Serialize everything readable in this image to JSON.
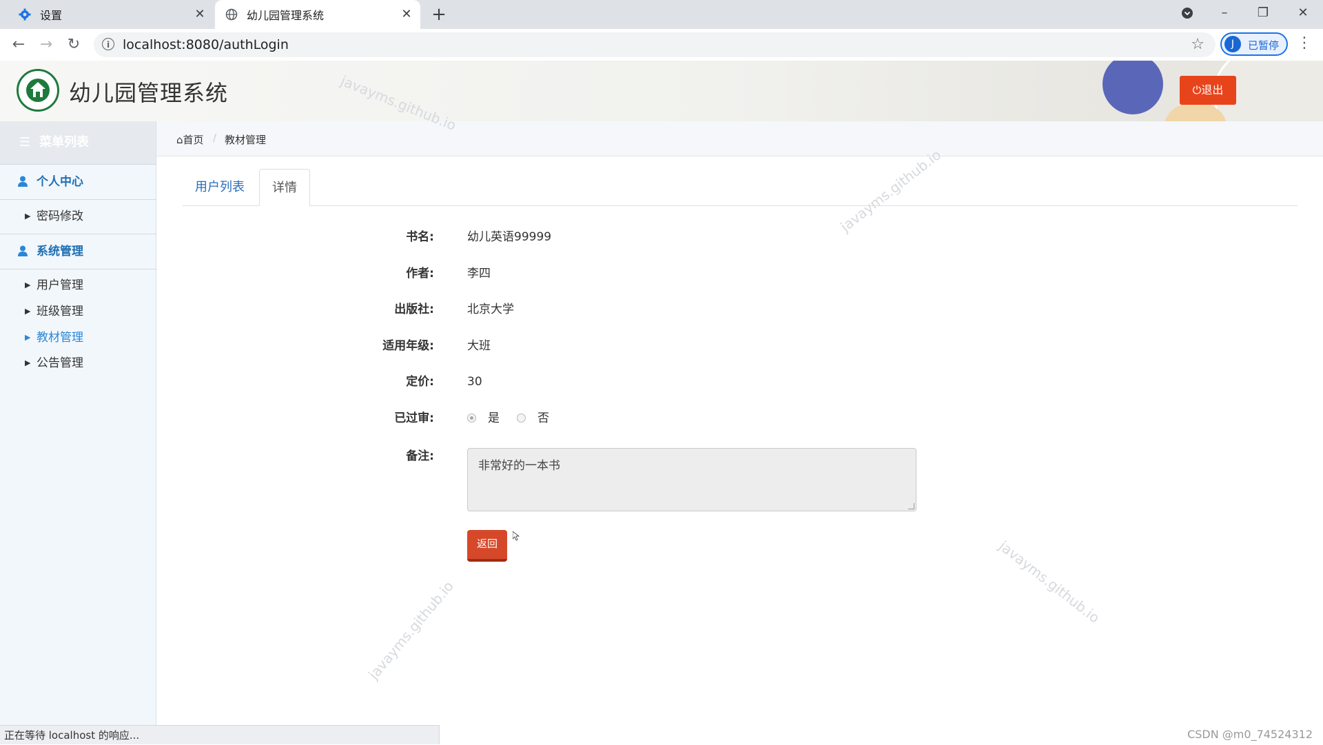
{
  "browser": {
    "tabs": [
      {
        "title": "设置"
      },
      {
        "title": "幼儿园管理系统"
      }
    ],
    "url": "localhost:8080/authLogin",
    "profile_initial": "J",
    "profile_label": "已暂停"
  },
  "header": {
    "title": "幼儿园管理系统",
    "logout_label": "退出"
  },
  "sidebar": {
    "menu_title": "菜单列表",
    "groups": [
      {
        "label": "个人中心",
        "items": [
          {
            "label": "密码修改"
          }
        ]
      },
      {
        "label": "系统管理",
        "items": [
          {
            "label": "用户管理"
          },
          {
            "label": "班级管理"
          },
          {
            "label": "教材管理",
            "active": true
          },
          {
            "label": "公告管理"
          }
        ]
      }
    ]
  },
  "breadcrumb": {
    "home": "首页",
    "current": "教材管理"
  },
  "tabs": [
    {
      "label": "用户列表"
    },
    {
      "label": "详情",
      "active": true
    }
  ],
  "detail": {
    "fields": [
      {
        "label": "书名:",
        "value": "幼儿英语99999"
      },
      {
        "label": "作者:",
        "value": "李四"
      },
      {
        "label": "出版社:",
        "value": "北京大学"
      },
      {
        "label": "适用年级:",
        "value": "大班"
      },
      {
        "label": "定价:",
        "value": "30"
      }
    ],
    "audit_label": "已过审:",
    "audit_options": [
      {
        "label": "是",
        "selected": true
      },
      {
        "label": "否",
        "selected": false
      }
    ],
    "remark_label": "备注:",
    "remark_value": "非常好的一本书",
    "back_label": "返回"
  },
  "watermark_text": "javayms.github.io",
  "status_text": "正在等待 localhost 的响应...",
  "credit": "CSDN @m0_74524312",
  "colors": {
    "accent": "#1f6fb3",
    "danger": "#e8441c"
  }
}
